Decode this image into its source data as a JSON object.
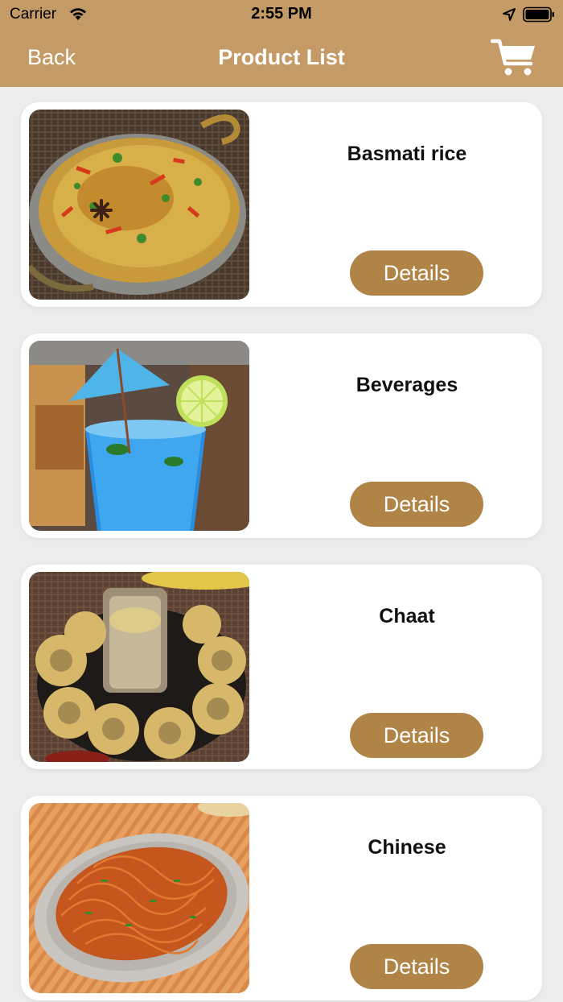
{
  "status_bar": {
    "carrier": "Carrier",
    "time": "2:55 PM"
  },
  "nav": {
    "back_label": "Back",
    "title": "Product List"
  },
  "products": [
    {
      "name": "Basmati rice",
      "details_label": "Details"
    },
    {
      "name": "Beverages",
      "details_label": "Details"
    },
    {
      "name": "Chaat",
      "details_label": "Details"
    },
    {
      "name": "Chinese",
      "details_label": "Details"
    }
  ],
  "colors": {
    "nav_bar": "#c49a66",
    "details_button": "#b08447",
    "background": "#ececec"
  },
  "icons": {
    "cart": "cart-icon",
    "wifi": "wifi-icon",
    "location": "location-arrow-icon",
    "battery": "battery-icon"
  }
}
